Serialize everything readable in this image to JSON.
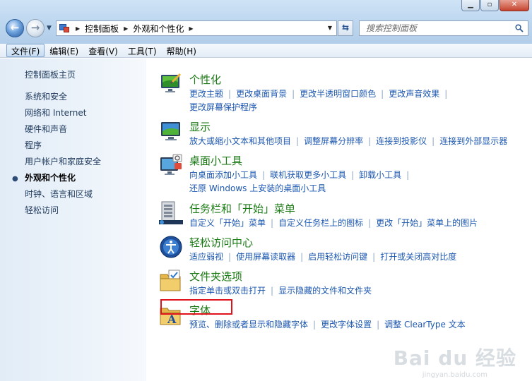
{
  "address": {
    "crumbs": [
      "控制面板",
      "外观和个性化"
    ],
    "search_placeholder": "搜索控制面板"
  },
  "menu": [
    "文件(F)",
    "编辑(E)",
    "查看(V)",
    "工具(T)",
    "帮助(H)"
  ],
  "left": {
    "home": "控制面板主页",
    "items": [
      "系统和安全",
      "网络和 Internet",
      "硬件和声音",
      "程序",
      "用户帐户和家庭安全",
      "外观和个性化",
      "时钟、语言和区域",
      "轻松访问"
    ],
    "current_index": 5
  },
  "categories": [
    {
      "title": "个性化",
      "icon": "personalization-icon",
      "links": [
        "更改主题",
        "更改桌面背景",
        "更改半透明窗口颜色",
        "更改声音效果",
        "更改屏幕保护程序"
      ]
    },
    {
      "title": "显示",
      "icon": "display-icon",
      "links": [
        "放大或缩小文本和其他项目",
        "调整屏幕分辨率",
        "连接到投影仪",
        "连接到外部显示器"
      ]
    },
    {
      "title": "桌面小工具",
      "icon": "desktop-gadgets-icon",
      "links": [
        "向桌面添加小工具",
        "联机获取更多小工具",
        "卸载小工具",
        "还原 Windows 上安装的桌面小工具"
      ]
    },
    {
      "title": "任务栏和「开始」菜单",
      "icon": "taskbar-icon",
      "links": [
        "自定义「开始」菜单",
        "自定义任务栏上的图标",
        "更改「开始」菜单上的图片"
      ]
    },
    {
      "title": "轻松访问中心",
      "icon": "ease-of-access-icon",
      "links": [
        "适应弱视",
        "使用屏幕读取器",
        "启用轻松访问键",
        "打开或关闭高对比度"
      ]
    },
    {
      "title": "文件夹选项",
      "icon": "folder-options-icon",
      "links": [
        "指定单击或双击打开",
        "显示隐藏的文件和文件夹"
      ]
    },
    {
      "title": "字体",
      "icon": "fonts-icon",
      "links": [
        "预览、删除或者显示和隐藏字体",
        "更改字体设置",
        "调整 ClearType 文本"
      ]
    }
  ],
  "highlighted_category": "字体",
  "watermark": {
    "line1": "Bai du 经验",
    "line2": "jingyan.baidu.com"
  },
  "colors": {
    "category_title": "#1a7a13",
    "link": "#1c57b0",
    "highlight_box": "#e0121b"
  }
}
